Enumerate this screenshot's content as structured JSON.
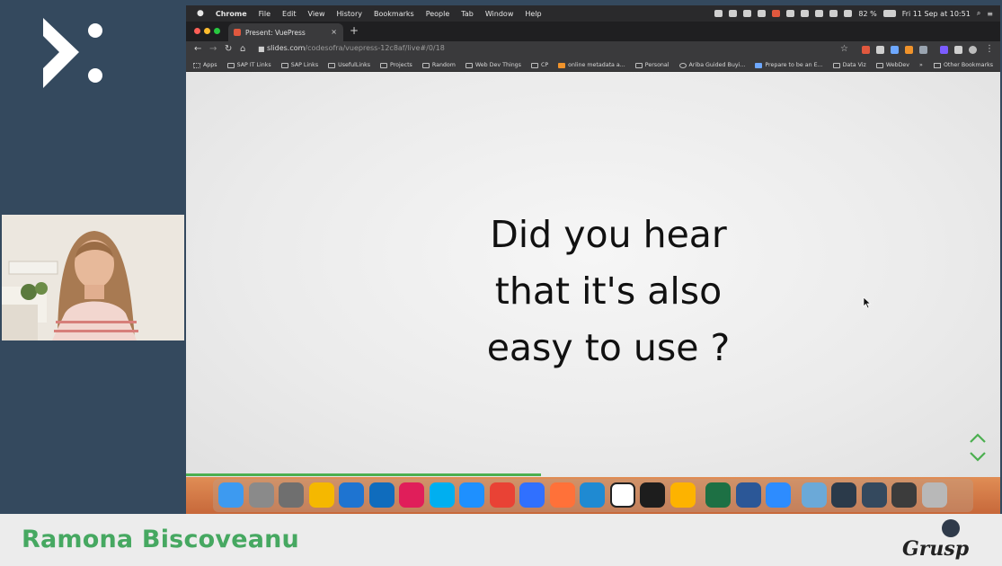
{
  "menubar": {
    "app_name": "Chrome",
    "menus": [
      "File",
      "Edit",
      "View",
      "History",
      "Bookmarks",
      "People",
      "Tab",
      "Window",
      "Help"
    ],
    "battery": "82 %",
    "datetime": "Fri 11 Sep at 10:51"
  },
  "browser": {
    "tab_title": "Present: VuePress",
    "tab_close": "×",
    "new_tab": "+",
    "url_domain": "slides.com",
    "url_path": "/codesofra/vuepress-12c8af/live#/0/18"
  },
  "bookmarks": [
    "Apps",
    "SAP IT Links",
    "SAP Links",
    "UsefulLinks",
    "Projects",
    "Random",
    "Web Dev Things",
    "CP",
    "online metadata a...",
    "Personal",
    "Ariba Guided Buyi...",
    "Prepare to be an E...",
    "Data Viz",
    "WebDev"
  ],
  "bookmarks_more": "»",
  "other_bookmarks": "Other Bookmarks",
  "slide": {
    "lines": [
      "Did you hear",
      "that it's also",
      "easy to use ?"
    ]
  },
  "speaker": {
    "name": "Ramona Biscoveanu"
  },
  "event_logo_text": "Grusp",
  "colors": {
    "sidebar": "#34495e",
    "speaker_name": "#46a861",
    "progress": "#4caf50",
    "dock_gradient": [
      "#e08d55",
      "#c7683a"
    ]
  },
  "dock_apps": [
    {
      "name": "finder-icon",
      "color": "#3d9af0"
    },
    {
      "name": "launchpad-icon",
      "color": "#8a8a8a"
    },
    {
      "name": "system-preferences-icon",
      "color": "#6f6f6f"
    },
    {
      "name": "lock-icon",
      "color": "#f5b800"
    },
    {
      "name": "onedrive-icon",
      "color": "#1e74d1"
    },
    {
      "name": "outlook-icon",
      "color": "#0f6cbd"
    },
    {
      "name": "slack-icon",
      "color": "#e01e5a"
    },
    {
      "name": "skype-icon",
      "color": "#00aff0"
    },
    {
      "name": "safari-icon",
      "color": "#1e90ff"
    },
    {
      "name": "chrome-icon",
      "color": "#e94235"
    },
    {
      "name": "firefox-developer-icon",
      "color": "#3070ff"
    },
    {
      "name": "firefox-icon",
      "color": "#ff7139"
    },
    {
      "name": "vscode-icon",
      "color": "#1f8ad2"
    },
    {
      "name": "notion-icon",
      "color": "#ffffff"
    },
    {
      "name": "terminal-icon",
      "color": "#1d1d1d"
    },
    {
      "name": "sketch-icon",
      "color": "#fdb300"
    },
    {
      "name": "excel-icon",
      "color": "#1d7044"
    },
    {
      "name": "word-icon",
      "color": "#2b5797"
    },
    {
      "name": "zoom-icon",
      "color": "#2d8cff"
    },
    {
      "name": "downloads-folder-icon",
      "color": "#6ba9d8"
    },
    {
      "name": "window-thumbnail-1-icon",
      "color": "#2b3a4a"
    },
    {
      "name": "window-thumbnail-2-icon",
      "color": "#34495e"
    },
    {
      "name": "window-thumbnail-3-icon",
      "color": "#3c3c3c"
    },
    {
      "name": "trash-icon",
      "color": "#b8b8b8"
    }
  ]
}
